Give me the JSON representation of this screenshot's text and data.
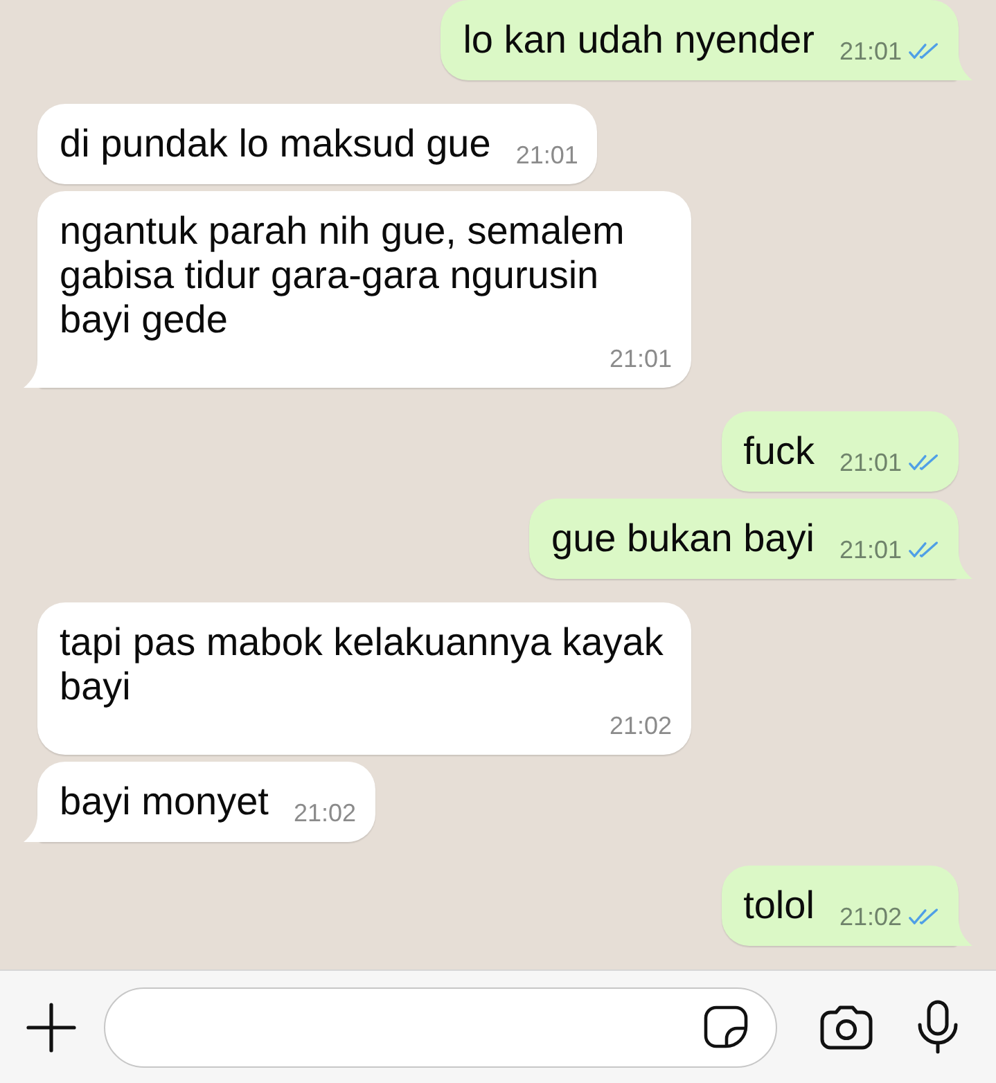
{
  "messages": [
    {
      "kind": "outgoing",
      "text": "lo kan udah nyender",
      "time": "21:01",
      "read": true
    },
    {
      "kind": "incoming",
      "text": "di pundak lo maksud gue",
      "time": "21:01"
    },
    {
      "kind": "incoming",
      "text": "ngantuk parah nih gue, semalem gabisa tidur gara-gara ngurusin bayi gede",
      "time": "21:01"
    },
    {
      "kind": "outgoing",
      "text": "fuck",
      "time": "21:01",
      "read": true
    },
    {
      "kind": "outgoing",
      "text": "gue bukan bayi",
      "time": "21:01",
      "read": true
    },
    {
      "kind": "incoming",
      "text": "tapi pas mabok kelakuannya kayak bayi",
      "time": "21:02"
    },
    {
      "kind": "incoming",
      "text": "bayi monyet",
      "time": "21:02"
    },
    {
      "kind": "outgoing",
      "text": "tolol",
      "time": "21:02",
      "read": true
    }
  ]
}
